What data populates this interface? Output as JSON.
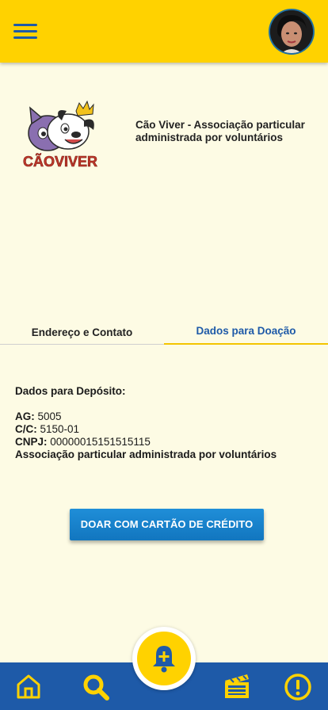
{
  "header": {
    "menu_icon": "hamburger-menu-icon",
    "avatar_icon": "user-avatar"
  },
  "organization": {
    "logo_text": "CÃOVIVER",
    "name": "Cão Viver - Associação particular administrada por voluntários"
  },
  "tabs": [
    {
      "label": "Endereço e Contato",
      "active": false
    },
    {
      "label": "Dados para Doação",
      "active": true
    }
  ],
  "deposit": {
    "title": "Dados para Depósito:",
    "ag_label": "AG:",
    "ag_value": "5005",
    "cc_label": "C/C:",
    "cc_value": "5150-01",
    "cnpj_label": "CNPJ:",
    "cnpj_value": "00000015151515115",
    "holder": "Associação particular administrada por voluntários"
  },
  "donate_button": {
    "label": "DOAR COM CARTÃO DE CRÉDITO"
  },
  "bottom_nav": {
    "items": [
      "home-icon",
      "search-icon",
      "notification-add-icon",
      "movie-icon",
      "alert-icon"
    ]
  },
  "colors": {
    "brand_yellow": "#ffd200",
    "brand_blue": "#1e5aa8",
    "background": "#fdfbe4",
    "button_blue": "#1a84cc"
  }
}
